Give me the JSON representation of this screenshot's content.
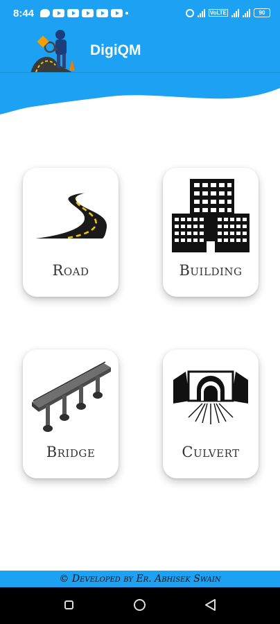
{
  "status_bar": {
    "time": "8:44",
    "left_icons": [
      "chat-icon",
      "youtube-icon",
      "youtube-icon",
      "youtube-icon",
      "youtube-icon",
      "youtube-icon",
      "dot-icon"
    ],
    "right_icons": [
      "hotspot-icon",
      "signal-icon",
      "volte-icon",
      "signal-icon",
      "signal-icon"
    ],
    "volte_label": "VoLTE",
    "battery": "90"
  },
  "app_bar": {
    "title": "DigiQM",
    "background_color": "#1da1f2"
  },
  "categories": [
    {
      "id": "road",
      "label": "Road",
      "icon": "road-icon"
    },
    {
      "id": "building",
      "label": "Building",
      "icon": "building-icon"
    },
    {
      "id": "bridge",
      "label": "Bridge",
      "icon": "bridge-icon"
    },
    {
      "id": "culvert",
      "label": "Culvert",
      "icon": "culvert-icon"
    }
  ],
  "footer": {
    "text": "© Developed by Er. Abhisek Swain"
  },
  "nav_bar": {
    "buttons": [
      "recents-button",
      "home-button",
      "back-button"
    ]
  }
}
